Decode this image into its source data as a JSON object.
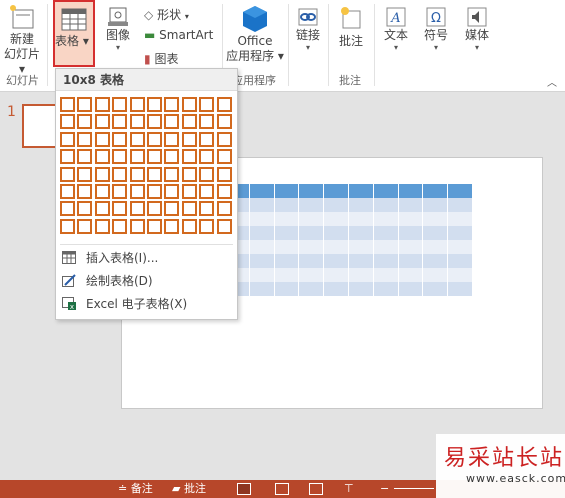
{
  "ribbon": {
    "new_slide": {
      "label1": "新建",
      "label2": "幻灯片"
    },
    "table": {
      "label": "表格"
    },
    "image": {
      "label": "图像"
    },
    "shapes": {
      "label": "形状"
    },
    "smartart": {
      "label": "SmartArt"
    },
    "chart": {
      "label": "图表"
    },
    "office_apps": {
      "label1": "Office",
      "label2": "应用程序"
    },
    "link": {
      "label": "链接"
    },
    "comment": {
      "label": "批注"
    },
    "text": {
      "label": "文本"
    },
    "symbol": {
      "label": "符号"
    },
    "media": {
      "label": "媒体"
    },
    "groups": {
      "slides": "幻灯片",
      "apps": "应用程序",
      "comments": "批注"
    }
  },
  "dropdown": {
    "title": "10x8 表格",
    "grid": {
      "cols": 10,
      "rows": 8,
      "selected_cols": 10,
      "selected_rows": 8
    },
    "items": [
      {
        "label": "插入表格(I)...",
        "icon": "table-icon"
      },
      {
        "label": "绘制表格(D)",
        "icon": "draw-table-icon"
      },
      {
        "label": "Excel 电子表格(X)",
        "icon": "excel-icon"
      }
    ]
  },
  "slides_pane": {
    "slide_number": "1"
  },
  "statusbar": {
    "notes": "备注",
    "comments": "批注"
  },
  "watermark": {
    "title": "易采站长站",
    "url": "www.easck.com"
  },
  "colors": {
    "accent": "#b7472a",
    "grid_border": "#d08a55",
    "table_header": "#5b9bd5",
    "table_band": "#d2deef"
  }
}
